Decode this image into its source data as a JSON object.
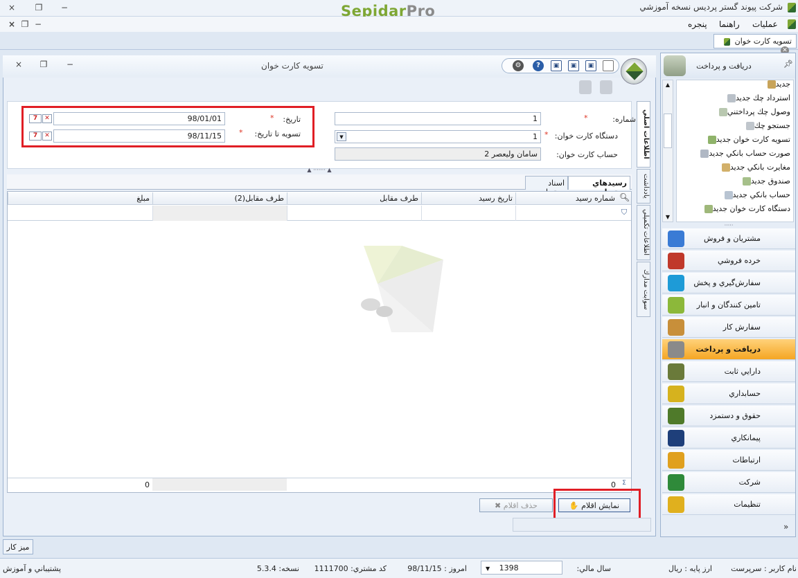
{
  "app": {
    "title": "شركت پيوند گستر پرديس نسخه آموزشي",
    "logo_sepidar": "Sepidar",
    "logo_pro": "Pro",
    "window_controls": [
      "×",
      "❐",
      "−"
    ],
    "mdi_controls": [
      "×",
      "❐",
      "−"
    ]
  },
  "menu": {
    "items": [
      "عمليات",
      "راهنما",
      "پنجره"
    ]
  },
  "doc_tab": {
    "label": "تسويه كارت خوان"
  },
  "form_window": {
    "title": "تسويه كارت خوان",
    "fields": {
      "number_label": "شماره:",
      "number_value": "1",
      "device_label": "دستگاه كارت خوان:",
      "device_value": "1",
      "account_label": "حساب كارت خوان:",
      "account_value": "سامان وليعصر 2",
      "date_label": "تاريخ:",
      "date_value": "98/01/01",
      "settle_until_label": "تسويه تا تاريخ:",
      "settle_until_value": "98/11/15",
      "required_mark": "*"
    },
    "vertical_tabs": [
      "اطلاعات اصلي",
      "يادداشت",
      "اطلاعات تكميلي",
      "سوابت مدارك"
    ],
    "sub_tabs": [
      "رسيدهاي مرتبط",
      "اسناد مرتبط"
    ],
    "grid": {
      "columns": [
        "شماره رسيد",
        "تاريخ رسيد",
        "طرف مقابل",
        "طرف مقابل(2)",
        "مبلغ"
      ],
      "footer_count": "0",
      "footer_sum": "0"
    },
    "buttons": {
      "show_items": "نمايش اقلام",
      "delete_items": "حذف اقلام"
    }
  },
  "side_panel": {
    "title": "دريافت و پرداخت",
    "list_items": [
      "جديد",
      "استرداد چك جديد",
      "وصول چك پرداختني",
      "جستجو چك",
      "تسويه كارت خوان جديد",
      "صورت حساب بانكي جديد",
      "مغايرت بانكي جديد",
      "صندوق جديد",
      "حساب بانكي جديد",
      "دستگاه كارت خوان جديد"
    ],
    "categories": [
      {
        "label": "مشتريان و فروش",
        "icon": "chart-icon",
        "color": "#3a7bd5"
      },
      {
        "label": "خرده فروشي",
        "icon": "cart-icon",
        "color": "#c0392b"
      },
      {
        "label": "سفارش‌گيري و پخش",
        "icon": "globe-icon",
        "color": "#1e9bd7"
      },
      {
        "label": "تامين كنندگان و انبار",
        "icon": "boxes-icon",
        "color": "#8cb83a"
      },
      {
        "label": "سفارش كار",
        "icon": "work-order-icon",
        "color": "#c88f3a"
      },
      {
        "label": "دريافت و پرداخت",
        "icon": "cash-icon",
        "color": "#8a8a8a",
        "active": true
      },
      {
        "label": "دارايي ثابت",
        "icon": "truck-icon",
        "color": "#6a7a3a"
      },
      {
        "label": "حسابداري",
        "icon": "ledger-icon",
        "color": "#d6b21e"
      },
      {
        "label": "حقوق و دستمزد",
        "icon": "money-icon",
        "color": "#4f7a2a"
      },
      {
        "label": "پيمانكاري",
        "icon": "handshake-icon",
        "color": "#1e3f7a"
      },
      {
        "label": "ارتباطات",
        "icon": "bulb-icon",
        "color": "#e0a01e"
      },
      {
        "label": "شركت",
        "icon": "company-icon",
        "color": "#2f8a3a"
      },
      {
        "label": "تنظيمات",
        "icon": "gear-icon",
        "color": "#e0b01e"
      }
    ]
  },
  "taskbar": {
    "desktop": "ميز كار"
  },
  "status": {
    "username_label": "نام كاربر :",
    "username": "سرپرست",
    "currency_label": "ارز پايه :",
    "currency": "ريال",
    "fiscal_year_label": "سال مالي:",
    "fiscal_year": "1398",
    "today_label": "امروز :",
    "today": "98/11/15",
    "customer_code_label": "كد مشتري:",
    "customer_code": "1111700",
    "version_label": "نسخه:",
    "version": "5.3.4",
    "support": "پشتيباني و آموزش"
  }
}
